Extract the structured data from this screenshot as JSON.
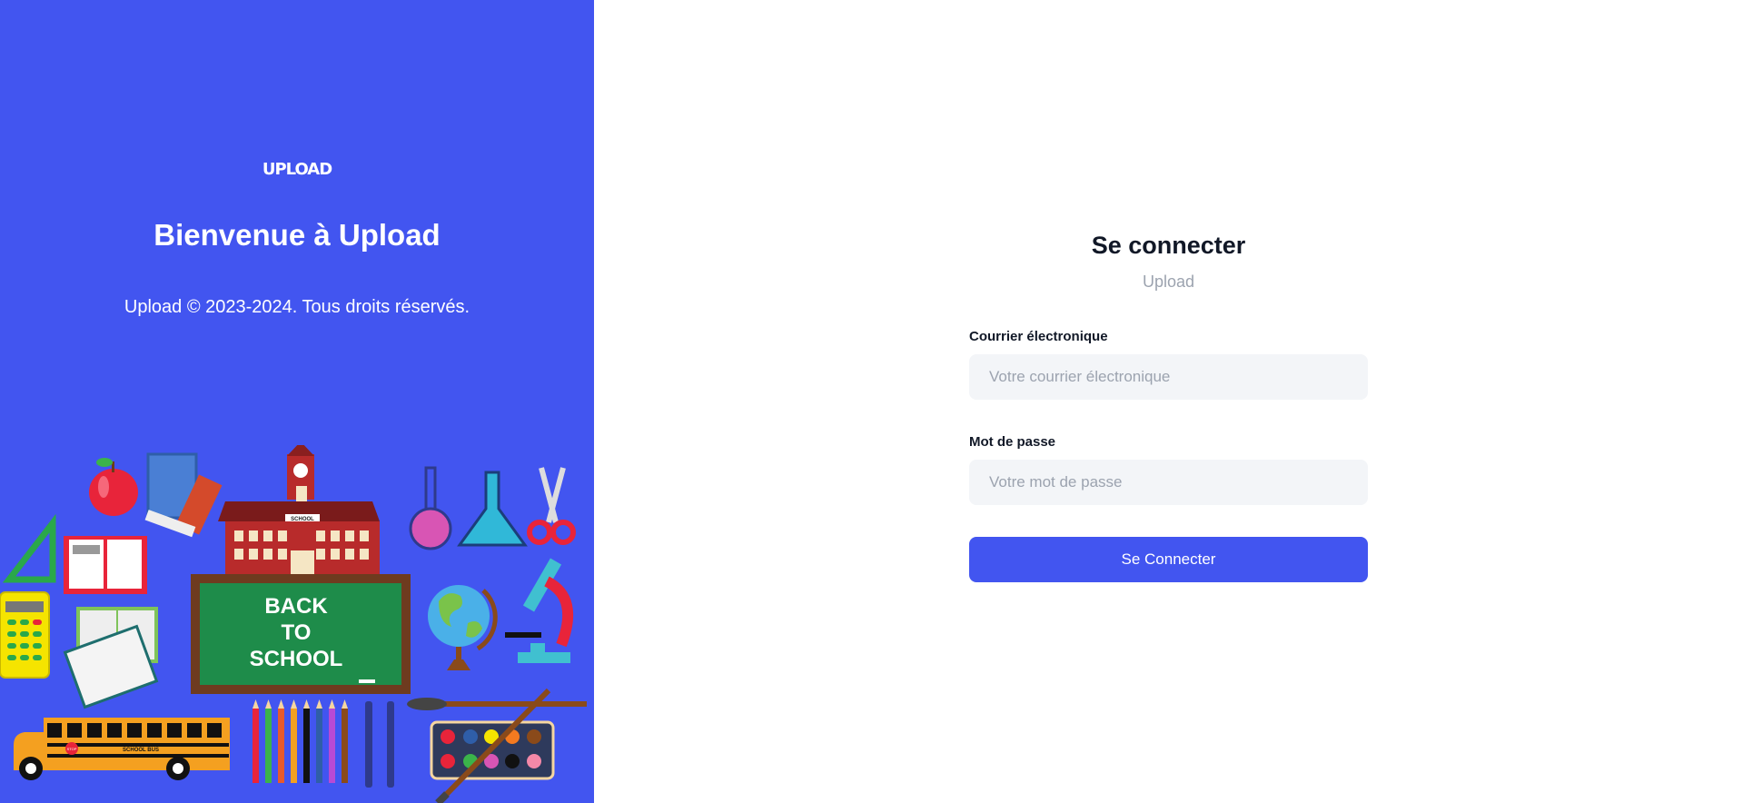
{
  "brand": {
    "logo_text": "UPLOAD",
    "logo_tagline": ""
  },
  "left_panel": {
    "welcome": "Bienvenue à Upload",
    "copyright": "Upload © 2023-2024. Tous droits réservés.",
    "illustration": {
      "board_lines": [
        "BACK",
        "TO",
        "SCHOOL"
      ],
      "building_sign": "SCHOOL",
      "bus_sign": "SCHOOL BUS",
      "bus_stop": "STOP"
    }
  },
  "login": {
    "title": "Se connecter",
    "subtitle": "Upload",
    "email_label": "Courrier électronique",
    "email_placeholder": "Votre courrier électronique",
    "email_value": "",
    "password_label": "Mot de passe",
    "password_placeholder": "Votre mot de passe",
    "password_value": "",
    "submit_label": "Se Connecter"
  },
  "colors": {
    "accent": "#4255f0",
    "input_bg": "#f3f5f8",
    "heading": "#111827",
    "muted": "#9ca3af"
  }
}
